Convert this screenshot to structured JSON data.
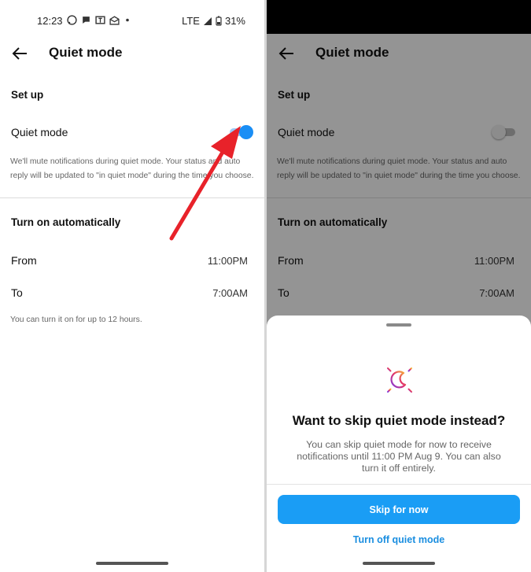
{
  "status_bar": {
    "time": "12:23",
    "network": "LTE",
    "battery": "31%"
  },
  "screen": {
    "title": "Quiet mode",
    "setup_heading": "Set up",
    "quiet_mode_label": "Quiet mode",
    "description": "We'll mute notifications during quiet mode. Your status and auto reply will be updated to \"in quiet mode\" during the time you choose.",
    "auto_heading": "Turn on automatically",
    "from_label": "From",
    "from_value": "11:00PM",
    "to_label": "To",
    "to_value": "7:00AM",
    "footnote": "You can turn it on for up to 12 hours."
  },
  "sheet": {
    "title": "Want to skip quiet mode instead?",
    "body": "You can skip quiet mode for now to receive notifications until 11:00 PM Aug 9. You can also turn it off entirely.",
    "primary_button": "Skip for now",
    "secondary_link": "Turn off quiet mode"
  },
  "colors": {
    "toggle_on_knob": "#1a8ef5",
    "toggle_on_track": "#9ccaf7",
    "toggle_off_knob": "#f2f2f2",
    "toggle_off_track": "#bdbdbd",
    "primary_button": "#1a9df5",
    "annotation_arrow": "#e8222a"
  },
  "icons": {
    "back": "arrow-left-icon",
    "quiet_mode": "moon-icon",
    "annotation": "red-arrow"
  },
  "toggle_state": {
    "left": true,
    "right": false
  }
}
